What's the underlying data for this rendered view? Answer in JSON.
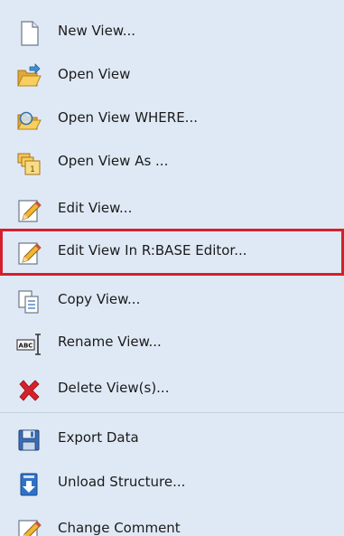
{
  "menu": {
    "items": [
      {
        "label": "New View...",
        "icon": "new-document-icon"
      },
      {
        "label": "Open View",
        "icon": "open-folder-icon"
      },
      {
        "label": "Open View WHERE...",
        "icon": "open-folder-search-icon"
      },
      {
        "label": "Open View As ...",
        "icon": "open-as-icon"
      },
      {
        "label": "Edit View...",
        "icon": "edit-pencil-icon"
      },
      {
        "label": "Edit View In R:BASE Editor...",
        "icon": "edit-pencil-icon",
        "highlighted": true
      },
      {
        "label": "Copy View...",
        "icon": "copy-document-icon"
      },
      {
        "label": "Rename View...",
        "icon": "rename-icon"
      },
      {
        "label": "Delete View(s)...",
        "icon": "delete-x-icon"
      },
      {
        "label": "Export Data",
        "icon": "save-disk-icon"
      },
      {
        "label": "Unload Structure...",
        "icon": "unload-arrow-icon"
      },
      {
        "label": "Change Comment",
        "icon": "edit-pencil-icon"
      }
    ]
  },
  "colors": {
    "background": "#dfe9f5",
    "highlight_border": "#d4202c",
    "separator": "#c4d0de"
  }
}
